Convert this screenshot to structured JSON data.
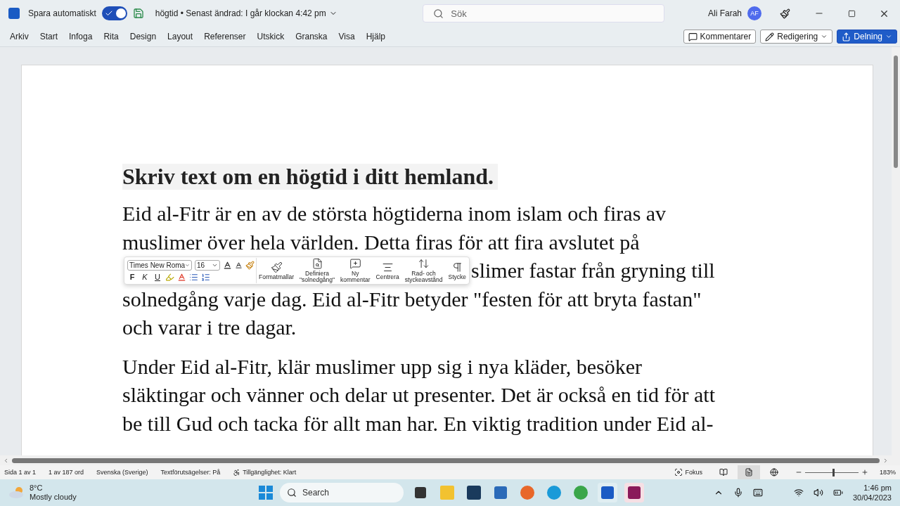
{
  "title_bar": {
    "autosave_label": "Spara automatiskt",
    "autosave_on": true,
    "document_title": "högtid • Senast ändrad: I går klockan 4:42 pm",
    "search_placeholder": "Sök",
    "user_name": "Ali Farah",
    "user_initials": "AF"
  },
  "menu": [
    "Arkiv",
    "Start",
    "Infoga",
    "Rita",
    "Design",
    "Layout",
    "Referenser",
    "Utskick",
    "Granska",
    "Visa",
    "Hjälp"
  ],
  "actions": [
    {
      "label": "Kommentarer",
      "kind": "comments"
    },
    {
      "label": "Redigering",
      "kind": "editing"
    },
    {
      "label": "Delning",
      "kind": "share"
    }
  ],
  "document": {
    "heading": "Skriv text om en högtid i ditt hemland.",
    "paragraphs": [
      {
        "lines": [
          {
            "text": "Eid al-Fitr är en av de största högtiderna inom islam och firas av",
            "toolbar": false
          },
          {
            "text": "muslimer över hela världen. Detta firas för att fira avslutet på",
            "toolbar": false
          },
          {
            "text": "slimer fastar från gryning till",
            "toolbar": true
          },
          {
            "text": "solnedgång varje dag. Eid al-Fitr betyder \"festen för att bryta fastan\"",
            "toolbar": false
          },
          {
            "text": "och varar i tre dagar.",
            "toolbar": false
          }
        ]
      },
      {
        "lines": [
          {
            "text": "Under Eid al-Fitr, klär muslimer upp sig i nya kläder, besöker",
            "toolbar": false
          },
          {
            "text": "släktingar och vänner och delar ut presenter. Det är också en tid för att",
            "toolbar": false
          },
          {
            "text": "be till Gud och tacka för allt man har. En viktig tradition under Eid al-",
            "toolbar": false
          }
        ]
      }
    ]
  },
  "mini_toolbar": {
    "font": "Times New Roma",
    "size": "16",
    "format_keys": [
      "F",
      "K",
      "U"
    ],
    "buttons": [
      {
        "label": "Formatmallar",
        "kind": "styles"
      },
      {
        "label": "Definiera \"solnedgång\"",
        "kind": "define"
      },
      {
        "label": "Ny kommentar",
        "kind": "comment"
      },
      {
        "label": "Centrera",
        "kind": "center"
      },
      {
        "label": "Rad- och styckeavstånd",
        "kind": "spacing"
      },
      {
        "label": "Stycke",
        "kind": "paragraph"
      }
    ]
  },
  "status_bar": {
    "items": [
      "Sida 1 av 1",
      "1 av 187 ord",
      "Svenska (Sverige)",
      "Textförutsägelser: På",
      "Tillgänglighet: Klart"
    ],
    "focus": "Fokus",
    "views": [
      {
        "kind": "read",
        "selected": false
      },
      {
        "kind": "print",
        "selected": true
      },
      {
        "kind": "web",
        "selected": false
      }
    ],
    "zoom": {
      "level": 0.52,
      "reading": "183%"
    }
  },
  "taskbar": {
    "weather_temp": "8°C",
    "weather_text": "Mostly cloudy",
    "search_placeholder": "Search",
    "time": "1:46 pm",
    "date": "30/04/2023"
  }
}
